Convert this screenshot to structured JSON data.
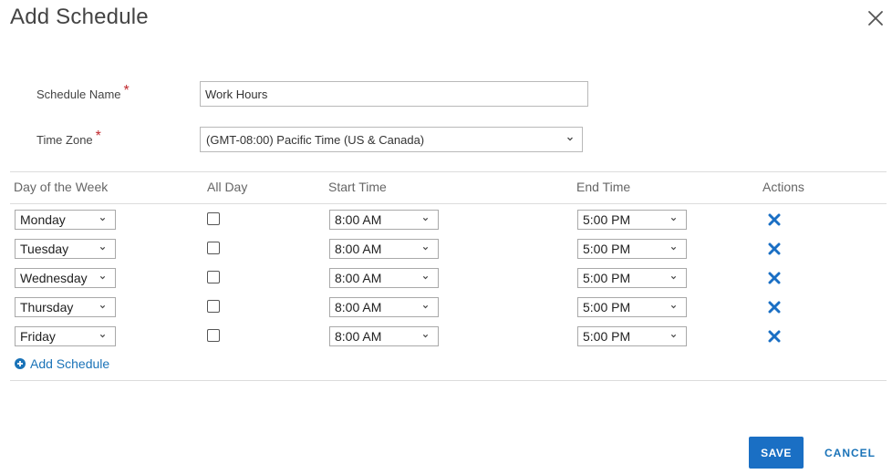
{
  "dialog": {
    "title": "Add Schedule",
    "close_icon": "close-icon"
  },
  "form": {
    "schedule_name_label": "Schedule Name",
    "schedule_name_value": "Work Hours",
    "time_zone_label": "Time Zone",
    "time_zone_value": "(GMT-08:00) Pacific Time (US & Canada)",
    "required_mark": "*"
  },
  "table": {
    "headers": {
      "day": "Day of the Week",
      "all_day": "All Day",
      "start": "Start Time",
      "end": "End Time",
      "actions": "Actions"
    },
    "rows": [
      {
        "day": "Monday",
        "all_day": false,
        "start": "8:00 AM",
        "end": "5:00 PM"
      },
      {
        "day": "Tuesday",
        "all_day": false,
        "start": "8:00 AM",
        "end": "5:00 PM"
      },
      {
        "day": "Wednesday",
        "all_day": false,
        "start": "8:00 AM",
        "end": "5:00 PM"
      },
      {
        "day": "Thursday",
        "all_day": false,
        "start": "8:00 AM",
        "end": "5:00 PM"
      },
      {
        "day": "Friday",
        "all_day": false,
        "start": "8:00 AM",
        "end": "5:00 PM"
      }
    ],
    "remove_icon": "remove-x-icon"
  },
  "add_schedule_label": "Add Schedule",
  "add_icon": "plus-circle-icon",
  "buttons": {
    "save": "SAVE",
    "cancel": "CANCEL"
  },
  "colors": {
    "accent": "#1a6fc4",
    "required": "#c0282d",
    "link": "#1a73b8"
  }
}
